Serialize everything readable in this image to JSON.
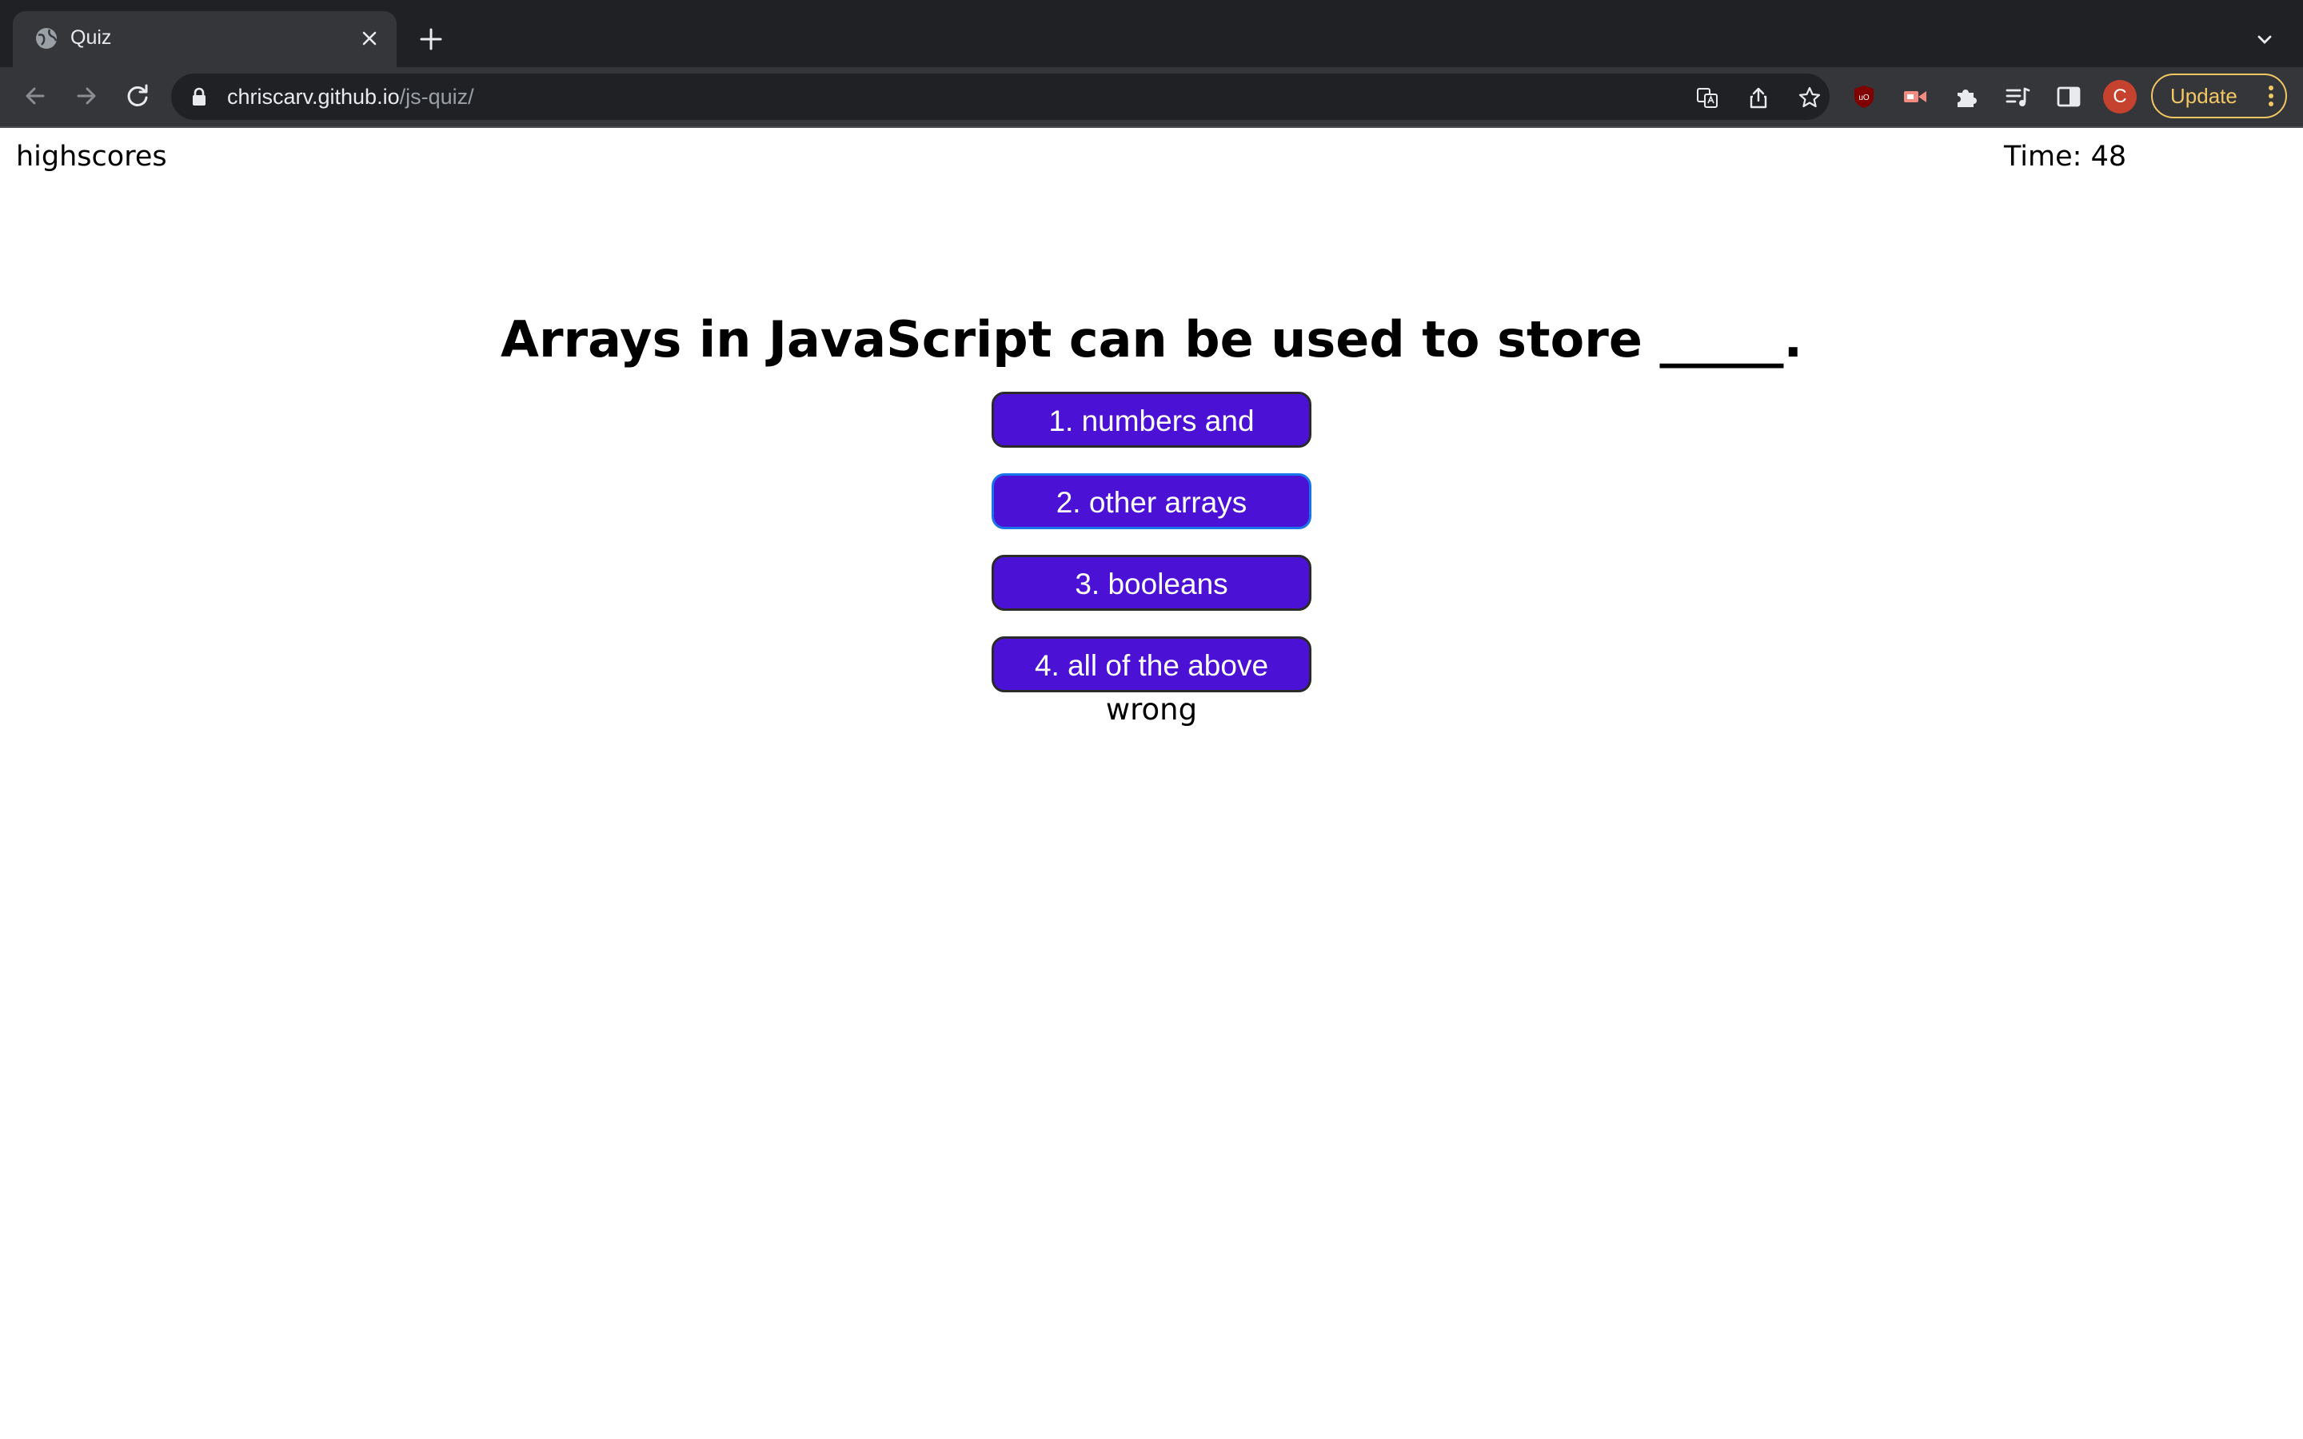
{
  "browser": {
    "tab": {
      "title": "Quiz",
      "favicon_icon": "globe-icon",
      "close_icon": "close-icon"
    },
    "new_tab_icon": "plus-icon",
    "tab_menu_icon": "chevron-down-icon",
    "nav": {
      "back_icon": "arrow-left-icon",
      "forward_icon": "arrow-right-icon",
      "reload_icon": "reload-icon"
    },
    "address": {
      "host": "chriscarv.github.io",
      "path": "/js-quiz/",
      "lock_icon": "lock-icon"
    },
    "omnibox_icons": [
      "translate-icon",
      "share-icon",
      "star-icon"
    ],
    "extension_icons": [
      "ublock-icon",
      "video-extension-icon",
      "puzzle-icon",
      "reading-list-icon",
      "side-panel-icon"
    ],
    "profile_initial": "C",
    "update_label": "Update",
    "colors": {
      "tabbar": "#202124",
      "toolbar": "#35363a",
      "update": "#f2c764",
      "profile": "#c5422f"
    }
  },
  "quiz": {
    "highscores_label": "highscores",
    "timer_label": "Time: 48",
    "question": "Arrays in JavaScript can be used to store _____.",
    "answers": [
      {
        "label": "1. numbers and"
      },
      {
        "label": "2. other arrays"
      },
      {
        "label": "3. booleans"
      },
      {
        "label": "4. all of the above"
      }
    ],
    "feedback": "wrong",
    "colors": {
      "answer_bg": "#4b12d6",
      "answer_text": "#ffffff"
    }
  }
}
